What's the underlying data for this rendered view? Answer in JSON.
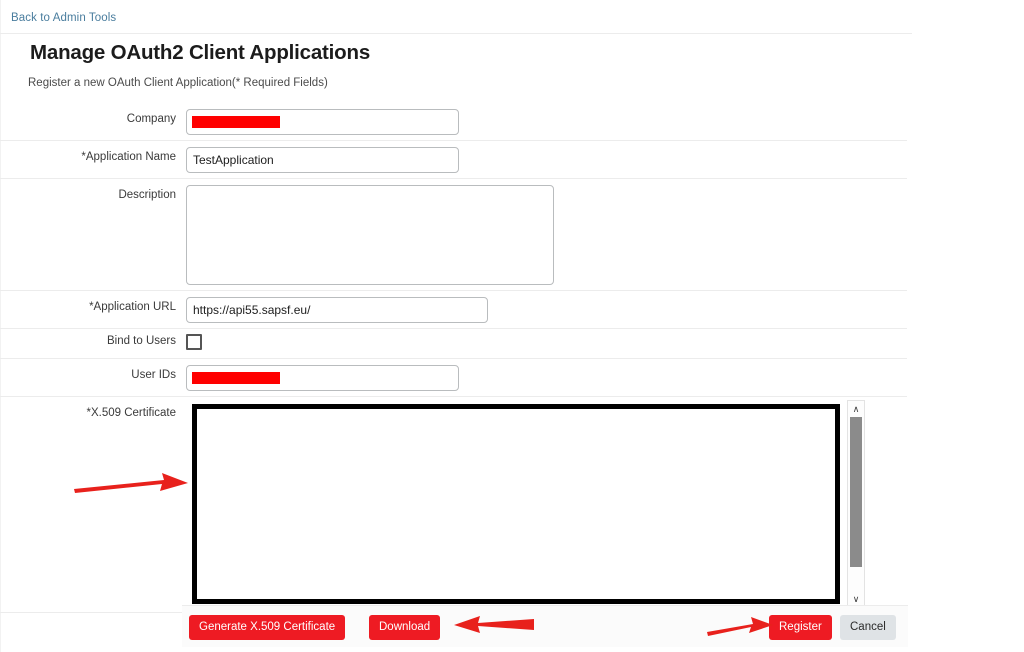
{
  "header": {
    "back_link": "Back to Admin Tools",
    "title": "Manage OAuth2 Client Applications",
    "subtitle": "Register a new OAuth Client Application(* Required Fields)"
  },
  "form": {
    "fields": [
      {
        "label": "Company",
        "value": "",
        "redacted": true
      },
      {
        "label": "*Application Name",
        "value": "TestApplication",
        "redacted": false
      },
      {
        "label": "Description",
        "value": "",
        "redacted": false
      },
      {
        "label": "*Application URL",
        "value": "https://api55.sapsf.eu/",
        "redacted": false
      },
      {
        "label": "Bind to Users",
        "value": "",
        "checked": false
      },
      {
        "label": "User IDs",
        "value": "",
        "redacted": true
      },
      {
        "label": "*X.509 Certificate",
        "value": "",
        "redacted": false
      }
    ]
  },
  "scrollbar": {
    "up_icon": "chevron-up-icon",
    "down_icon": "chevron-down-icon",
    "up_glyph": "∧",
    "down_glyph": "∨"
  },
  "footer": {
    "generate_label": "Generate X.509 Certificate",
    "download_label": "Download",
    "register_label": "Register",
    "cancel_label": "Cancel"
  },
  "annotations": {
    "arrow_color": "#e8211c",
    "arrows": [
      {
        "name": "arrow-to-certificate-box",
        "direction": "right"
      },
      {
        "name": "arrow-to-download-button",
        "direction": "left"
      },
      {
        "name": "arrow-to-register-button",
        "direction": "right"
      }
    ]
  },
  "colors": {
    "accent_red": "#ee1b23",
    "link_blue": "#4a7d9e",
    "redaction": "#ff0000",
    "cert_border": "#000000"
  }
}
